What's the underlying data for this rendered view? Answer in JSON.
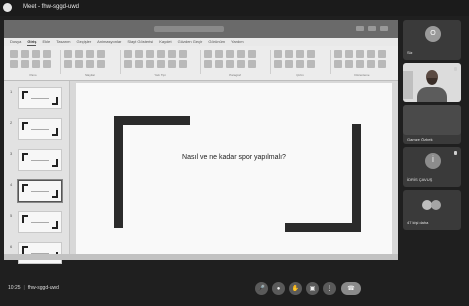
{
  "window": {
    "title": "Meet - fhw-sggd-uwd"
  },
  "powerpoint": {
    "menu": [
      "Dosya",
      "Giriş",
      "Ekle",
      "Tasarım",
      "Geçişler",
      "Animasyonlar",
      "Slayt Gösterisi",
      "Kaydet",
      "Gözden Geçir",
      "Görünüm",
      "Yardım"
    ],
    "active_menu": "Giriş",
    "toolbar_groups": [
      "Pano",
      "Slaytlar",
      "Yazı Tipi",
      "Paragraf",
      "Çizim",
      "Düzenleme"
    ],
    "slide_numbers": [
      "1",
      "2",
      "3",
      "4",
      "5",
      "6"
    ],
    "selected_slide": 4,
    "slide_title": "Nasıl ve ne kadar spor yapılmalı?"
  },
  "participants": [
    {
      "initial": "O",
      "name": "Siz",
      "type": "avatar"
    },
    {
      "name": "",
      "type": "video"
    },
    {
      "name": "Gamze Özbek",
      "type": "video-blurred"
    },
    {
      "initial": "İ",
      "name": "İDRİS ÇAVUŞ",
      "type": "avatar"
    },
    {
      "name": "47 kişi daha",
      "type": "group",
      "more_count": 47
    }
  ],
  "meeting": {
    "time": "10:25",
    "code": "fhw-sggd-uwd"
  },
  "controls": [
    "mic-icon",
    "camera-icon",
    "raise-hand-icon",
    "present-icon",
    "more-icon",
    "end-call-icon"
  ]
}
